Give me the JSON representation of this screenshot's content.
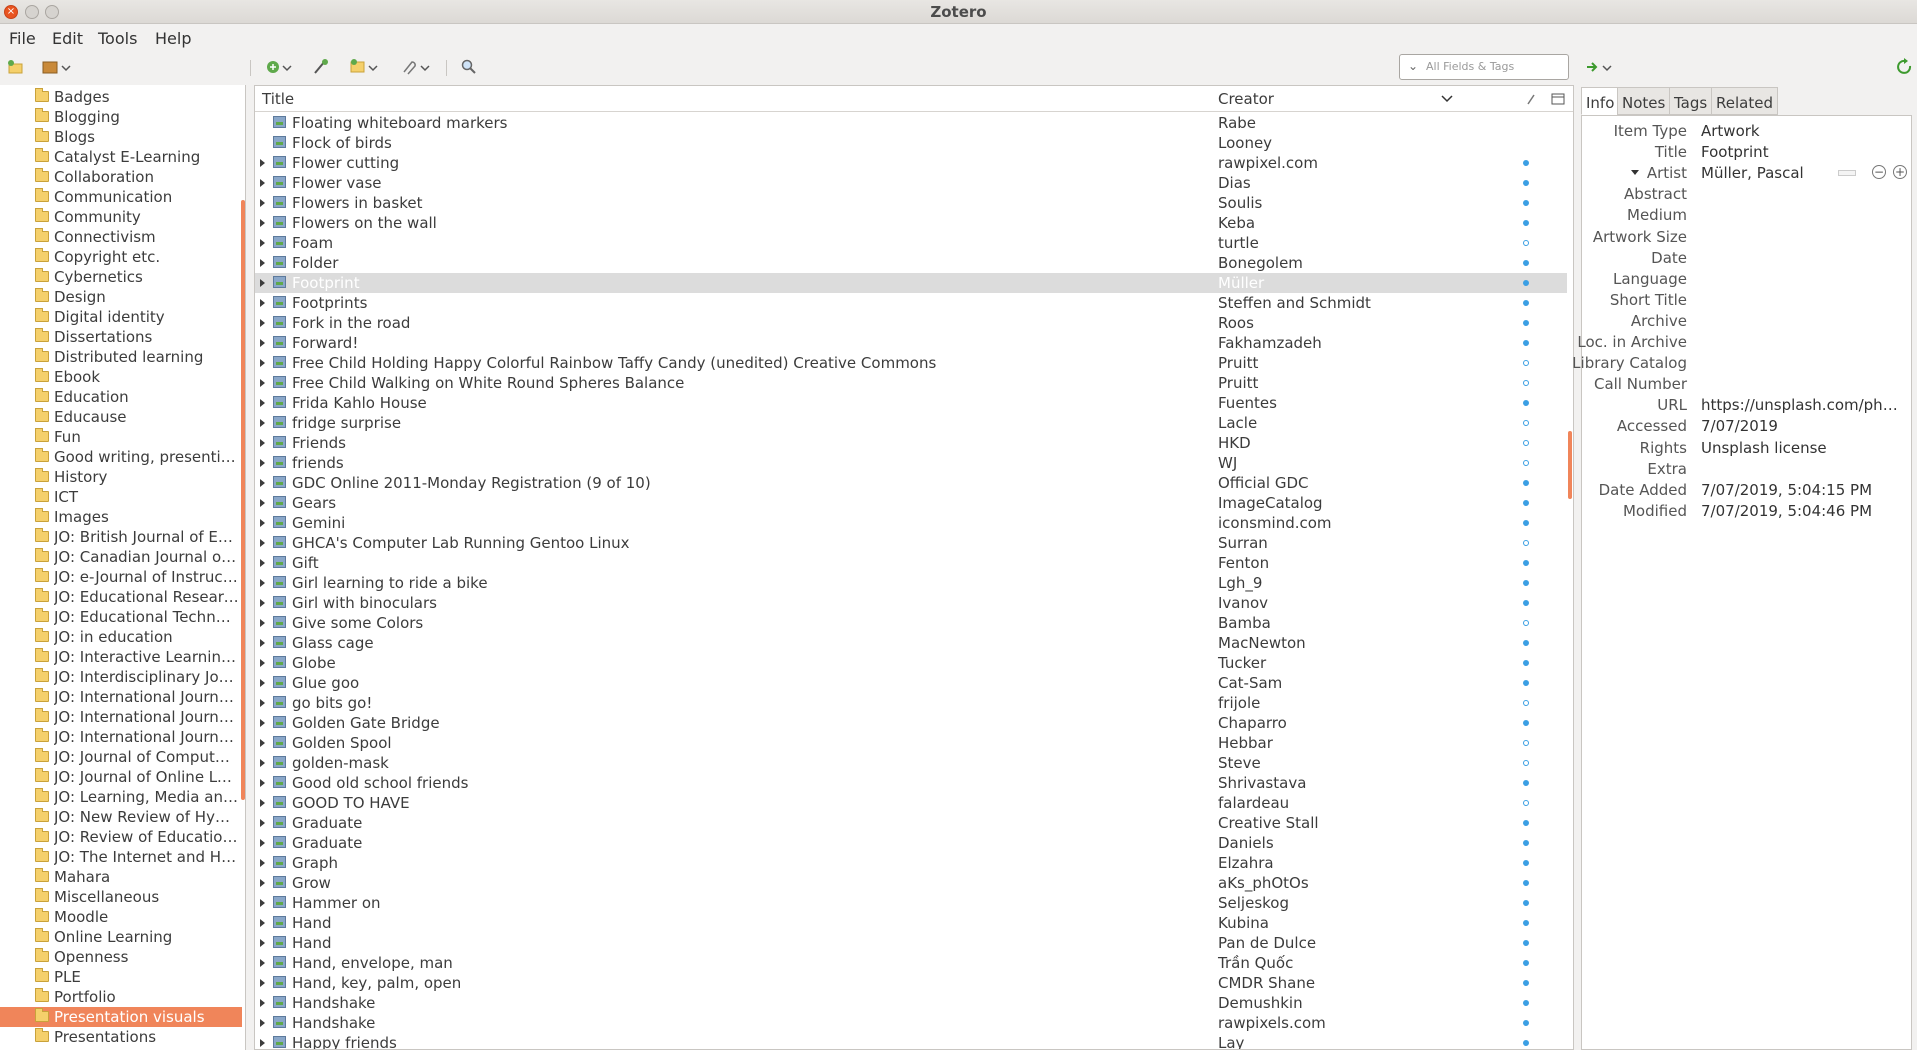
{
  "window": {
    "title": "Zotero"
  },
  "menu": [
    "File",
    "Edit",
    "Tools",
    "Help"
  ],
  "search": {
    "placeholder": "All Fields & Tags"
  },
  "collections": [
    "Badges",
    "Blogging",
    "Blogs",
    "Catalyst E-Learning",
    "Collaboration",
    "Communication",
    "Community",
    "Connectivism",
    "Copyright etc.",
    "Cybernetics",
    "Design",
    "Digital identity",
    "Dissertations",
    "Distributed learning",
    "Ebook",
    "Education",
    "Educause",
    "Fun",
    "Good writing, presenting ...",
    "History",
    "ICT",
    "Images",
    "JO: British Journal of Edu...",
    "JO: Canadian Journal of L...",
    "JO: e-Journal of Instructi...",
    "JO: Educational Researcher",
    "JO: Educational Technolo...",
    "JO: in education",
    "JO: Interactive Learning E...",
    "JO: Interdisciplinary Jour...",
    "JO: International Journal ...",
    "JO: International Journal ...",
    "JO: International Journal ...",
    "JO: Journal of Computer ...",
    "JO: Journal of Online Lea...",
    "JO: Learning, Media and ...",
    "JO: New Review of Hyper...",
    "JO: Review of Educationa...",
    "JO: The Internet and High...",
    "Mahara",
    "Miscellaneous",
    "Moodle",
    "Online Learning",
    "Openness",
    "PLE",
    "Portfolio",
    "Presentation visuals",
    "Presentations"
  ],
  "selected_collection": "Presentation visuals",
  "columns": {
    "title": "Title",
    "creator": "Creator"
  },
  "items": [
    {
      "title": "Floating whiteboard markers",
      "creator": "Rabe",
      "twisty": false,
      "dot": ""
    },
    {
      "title": "Flock of birds",
      "creator": "Looney",
      "twisty": false,
      "dot": ""
    },
    {
      "title": "Flower cutting",
      "creator": "rawpixel.com",
      "twisty": true,
      "dot": "full"
    },
    {
      "title": "Flower vase",
      "creator": "Dias",
      "twisty": true,
      "dot": "full"
    },
    {
      "title": "Flowers in basket",
      "creator": "Soulis",
      "twisty": true,
      "dot": "full"
    },
    {
      "title": "Flowers on the wall",
      "creator": "Keba",
      "twisty": true,
      "dot": "full"
    },
    {
      "title": "Foam",
      "creator": "turtle",
      "twisty": true,
      "dot": "empty"
    },
    {
      "title": "Folder",
      "creator": "Bonegolem",
      "twisty": true,
      "dot": "full"
    },
    {
      "title": "Footprint",
      "creator": "Müller",
      "twisty": true,
      "dot": "full",
      "selected": true
    },
    {
      "title": "Footprints",
      "creator": "Steffen and Schmidt",
      "twisty": true,
      "dot": "full"
    },
    {
      "title": "Fork in the road",
      "creator": "Roos",
      "twisty": true,
      "dot": "full"
    },
    {
      "title": "Forward!",
      "creator": "Fakhamzadeh",
      "twisty": true,
      "dot": "full"
    },
    {
      "title": "Free Child Holding Happy Colorful Rainbow Taffy Candy (unedited) Creative Commons",
      "creator": "Pruitt",
      "twisty": true,
      "dot": "empty"
    },
    {
      "title": "Free Child Walking on White Round Spheres Balance",
      "creator": "Pruitt",
      "twisty": true,
      "dot": "empty"
    },
    {
      "title": "Frida Kahlo House",
      "creator": "Fuentes",
      "twisty": true,
      "dot": "full"
    },
    {
      "title": "fridge surprise",
      "creator": "Lacle",
      "twisty": true,
      "dot": "empty"
    },
    {
      "title": "Friends",
      "creator": "HKD",
      "twisty": true,
      "dot": "empty"
    },
    {
      "title": "friends",
      "creator": "WJ",
      "twisty": true,
      "dot": "empty"
    },
    {
      "title": "GDC Online 2011-Monday Registration (9 of 10)",
      "creator": "Official GDC",
      "twisty": true,
      "dot": "full"
    },
    {
      "title": "Gears",
      "creator": "ImageCatalog",
      "twisty": true,
      "dot": "full"
    },
    {
      "title": "Gemini",
      "creator": "iconsmind.com",
      "twisty": true,
      "dot": "full"
    },
    {
      "title": "GHCA's Computer Lab Running Gentoo Linux",
      "creator": "Surran",
      "twisty": true,
      "dot": "empty"
    },
    {
      "title": "Gift",
      "creator": "Fenton",
      "twisty": true,
      "dot": "full"
    },
    {
      "title": "Girl learning to ride a bike",
      "creator": "Lgh_9",
      "twisty": true,
      "dot": "full"
    },
    {
      "title": "Girl with binoculars",
      "creator": "Ivanov",
      "twisty": true,
      "dot": "full"
    },
    {
      "title": "Give some Colors",
      "creator": "Bamba",
      "twisty": true,
      "dot": "empty"
    },
    {
      "title": "Glass cage",
      "creator": "MacNewton",
      "twisty": true,
      "dot": "full"
    },
    {
      "title": "Globe",
      "creator": "Tucker",
      "twisty": true,
      "dot": "full"
    },
    {
      "title": "Glue goo",
      "creator": "Cat-Sam",
      "twisty": true,
      "dot": "full"
    },
    {
      "title": "go bits go!",
      "creator": "frijole",
      "twisty": true,
      "dot": "empty"
    },
    {
      "title": "Golden Gate Bridge",
      "creator": "Chaparro",
      "twisty": true,
      "dot": "full"
    },
    {
      "title": "Golden Spool",
      "creator": "Hebbar",
      "twisty": true,
      "dot": "empty"
    },
    {
      "title": "golden-mask",
      "creator": "Steve",
      "twisty": true,
      "dot": "empty"
    },
    {
      "title": "Good old school friends",
      "creator": "Shrivastava",
      "twisty": true,
      "dot": "full"
    },
    {
      "title": "GOOD TO HAVE",
      "creator": "falardeau",
      "twisty": true,
      "dot": "empty"
    },
    {
      "title": "Graduate",
      "creator": "Creative Stall",
      "twisty": true,
      "dot": "full"
    },
    {
      "title": "Graduate",
      "creator": "Daniels",
      "twisty": true,
      "dot": "full"
    },
    {
      "title": "Graph",
      "creator": "Elzahra",
      "twisty": true,
      "dot": "full"
    },
    {
      "title": "Grow",
      "creator": "aKs_phOtOs",
      "twisty": true,
      "dot": "full"
    },
    {
      "title": "Hammer on",
      "creator": "Seljeskog",
      "twisty": true,
      "dot": "full"
    },
    {
      "title": "Hand",
      "creator": "Kubina",
      "twisty": true,
      "dot": "full"
    },
    {
      "title": "Hand",
      "creator": "Pan de Dulce",
      "twisty": true,
      "dot": "full"
    },
    {
      "title": "Hand, envelope, man",
      "creator": "Trần Quốc",
      "twisty": true,
      "dot": "full"
    },
    {
      "title": "Hand, key, palm, open",
      "creator": "CMDR Shane",
      "twisty": true,
      "dot": "full"
    },
    {
      "title": "Handshake",
      "creator": "Demushkin",
      "twisty": true,
      "dot": "full"
    },
    {
      "title": "Handshake",
      "creator": "rawpixels.com",
      "twisty": true,
      "dot": "full"
    },
    {
      "title": "Happy friends",
      "creator": "Lay",
      "twisty": true,
      "dot": "full"
    }
  ],
  "tabs": [
    "Info",
    "Notes",
    "Tags",
    "Related"
  ],
  "info": [
    {
      "k": "Item Type",
      "v": "Artwork"
    },
    {
      "k": "Title",
      "v": "Footprint"
    },
    {
      "k": "Artist",
      "v": "Müller, Pascal"
    },
    {
      "k": "Abstract",
      "v": ""
    },
    {
      "k": "Medium",
      "v": ""
    },
    {
      "k": "Artwork Size",
      "v": ""
    },
    {
      "k": "Date",
      "v": ""
    },
    {
      "k": "Language",
      "v": ""
    },
    {
      "k": "Short Title",
      "v": ""
    },
    {
      "k": "Archive",
      "v": ""
    },
    {
      "k": "Loc. in Archive",
      "v": ""
    },
    {
      "k": "Library Catalog",
      "v": ""
    },
    {
      "k": "Call Number",
      "v": ""
    },
    {
      "k": "URL",
      "v": "https://unsplash.com/phot..."
    },
    {
      "k": "Accessed",
      "v": "7/07/2019"
    },
    {
      "k": "Rights",
      "v": "Unsplash license"
    },
    {
      "k": "Extra",
      "v": ""
    },
    {
      "k": "Date Added",
      "v": "7/07/2019, 5:04:15 PM"
    },
    {
      "k": "Modified",
      "v": "7/07/2019, 5:04:46 PM"
    }
  ],
  "icons": [
    "new-collection-icon",
    "library-menu-icon",
    "new-item-icon",
    "add-by-identifier-icon",
    "new-note-icon",
    "attachment-icon",
    "advanced-search-icon",
    "locate-icon",
    "sync-icon"
  ],
  "colors": {
    "accent": "#f0855a",
    "selected_row": "#dcdcdc",
    "dot": "#3b9fe4"
  }
}
